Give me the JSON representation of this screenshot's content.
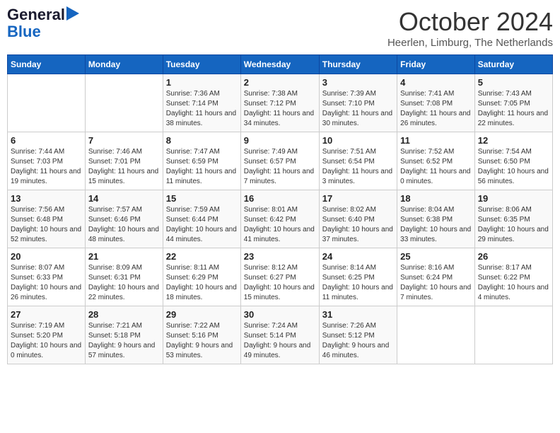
{
  "header": {
    "logo_line1": "General",
    "logo_line2": "Blue",
    "month_title": "October 2024",
    "subtitle": "Heerlen, Limburg, The Netherlands"
  },
  "days_of_week": [
    "Sunday",
    "Monday",
    "Tuesday",
    "Wednesday",
    "Thursday",
    "Friday",
    "Saturday"
  ],
  "weeks": [
    [
      {
        "day": "",
        "info": ""
      },
      {
        "day": "",
        "info": ""
      },
      {
        "day": "1",
        "info": "Sunrise: 7:36 AM\nSunset: 7:14 PM\nDaylight: 11 hours and 38 minutes."
      },
      {
        "day": "2",
        "info": "Sunrise: 7:38 AM\nSunset: 7:12 PM\nDaylight: 11 hours and 34 minutes."
      },
      {
        "day": "3",
        "info": "Sunrise: 7:39 AM\nSunset: 7:10 PM\nDaylight: 11 hours and 30 minutes."
      },
      {
        "day": "4",
        "info": "Sunrise: 7:41 AM\nSunset: 7:08 PM\nDaylight: 11 hours and 26 minutes."
      },
      {
        "day": "5",
        "info": "Sunrise: 7:43 AM\nSunset: 7:05 PM\nDaylight: 11 hours and 22 minutes."
      }
    ],
    [
      {
        "day": "6",
        "info": "Sunrise: 7:44 AM\nSunset: 7:03 PM\nDaylight: 11 hours and 19 minutes."
      },
      {
        "day": "7",
        "info": "Sunrise: 7:46 AM\nSunset: 7:01 PM\nDaylight: 11 hours and 15 minutes."
      },
      {
        "day": "8",
        "info": "Sunrise: 7:47 AM\nSunset: 6:59 PM\nDaylight: 11 hours and 11 minutes."
      },
      {
        "day": "9",
        "info": "Sunrise: 7:49 AM\nSunset: 6:57 PM\nDaylight: 11 hours and 7 minutes."
      },
      {
        "day": "10",
        "info": "Sunrise: 7:51 AM\nSunset: 6:54 PM\nDaylight: 11 hours and 3 minutes."
      },
      {
        "day": "11",
        "info": "Sunrise: 7:52 AM\nSunset: 6:52 PM\nDaylight: 11 hours and 0 minutes."
      },
      {
        "day": "12",
        "info": "Sunrise: 7:54 AM\nSunset: 6:50 PM\nDaylight: 10 hours and 56 minutes."
      }
    ],
    [
      {
        "day": "13",
        "info": "Sunrise: 7:56 AM\nSunset: 6:48 PM\nDaylight: 10 hours and 52 minutes."
      },
      {
        "day": "14",
        "info": "Sunrise: 7:57 AM\nSunset: 6:46 PM\nDaylight: 10 hours and 48 minutes."
      },
      {
        "day": "15",
        "info": "Sunrise: 7:59 AM\nSunset: 6:44 PM\nDaylight: 10 hours and 44 minutes."
      },
      {
        "day": "16",
        "info": "Sunrise: 8:01 AM\nSunset: 6:42 PM\nDaylight: 10 hours and 41 minutes."
      },
      {
        "day": "17",
        "info": "Sunrise: 8:02 AM\nSunset: 6:40 PM\nDaylight: 10 hours and 37 minutes."
      },
      {
        "day": "18",
        "info": "Sunrise: 8:04 AM\nSunset: 6:38 PM\nDaylight: 10 hours and 33 minutes."
      },
      {
        "day": "19",
        "info": "Sunrise: 8:06 AM\nSunset: 6:35 PM\nDaylight: 10 hours and 29 minutes."
      }
    ],
    [
      {
        "day": "20",
        "info": "Sunrise: 8:07 AM\nSunset: 6:33 PM\nDaylight: 10 hours and 26 minutes."
      },
      {
        "day": "21",
        "info": "Sunrise: 8:09 AM\nSunset: 6:31 PM\nDaylight: 10 hours and 22 minutes."
      },
      {
        "day": "22",
        "info": "Sunrise: 8:11 AM\nSunset: 6:29 PM\nDaylight: 10 hours and 18 minutes."
      },
      {
        "day": "23",
        "info": "Sunrise: 8:12 AM\nSunset: 6:27 PM\nDaylight: 10 hours and 15 minutes."
      },
      {
        "day": "24",
        "info": "Sunrise: 8:14 AM\nSunset: 6:25 PM\nDaylight: 10 hours and 11 minutes."
      },
      {
        "day": "25",
        "info": "Sunrise: 8:16 AM\nSunset: 6:24 PM\nDaylight: 10 hours and 7 minutes."
      },
      {
        "day": "26",
        "info": "Sunrise: 8:17 AM\nSunset: 6:22 PM\nDaylight: 10 hours and 4 minutes."
      }
    ],
    [
      {
        "day": "27",
        "info": "Sunrise: 7:19 AM\nSunset: 5:20 PM\nDaylight: 10 hours and 0 minutes."
      },
      {
        "day": "28",
        "info": "Sunrise: 7:21 AM\nSunset: 5:18 PM\nDaylight: 9 hours and 57 minutes."
      },
      {
        "day": "29",
        "info": "Sunrise: 7:22 AM\nSunset: 5:16 PM\nDaylight: 9 hours and 53 minutes."
      },
      {
        "day": "30",
        "info": "Sunrise: 7:24 AM\nSunset: 5:14 PM\nDaylight: 9 hours and 49 minutes."
      },
      {
        "day": "31",
        "info": "Sunrise: 7:26 AM\nSunset: 5:12 PM\nDaylight: 9 hours and 46 minutes."
      },
      {
        "day": "",
        "info": ""
      },
      {
        "day": "",
        "info": ""
      }
    ]
  ]
}
